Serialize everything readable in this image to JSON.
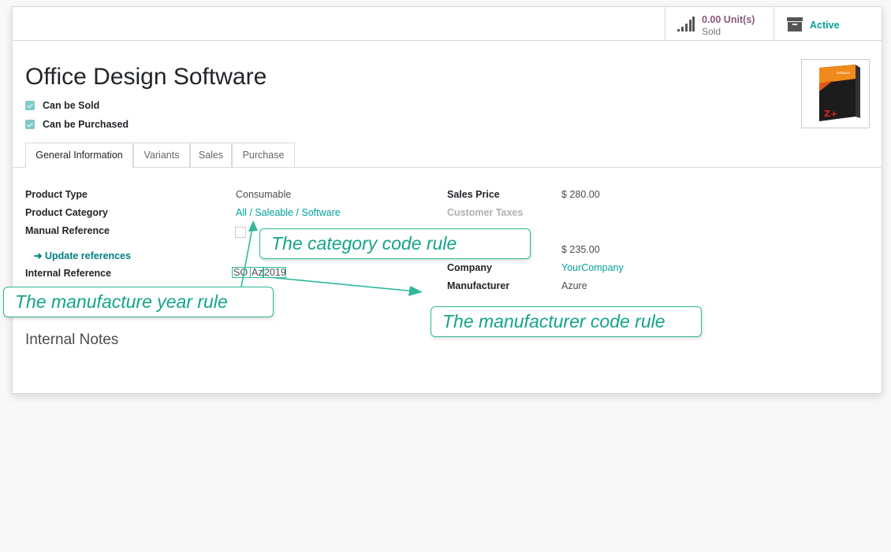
{
  "status": {
    "sold_value": "0.00 Unit(s)",
    "sold_label": "Sold",
    "active_label": "Active"
  },
  "product": {
    "title": "Office Design Software",
    "can_be_sold": "Can be Sold",
    "can_be_purchased": "Can be Purchased"
  },
  "tabs": [
    "General Information",
    "Variants",
    "Sales",
    "Purchase"
  ],
  "fields": {
    "product_type_label": "Product Type",
    "product_type_value": "Consumable",
    "product_category_label": "Product Category",
    "product_category_value": "All / Saleable / Software",
    "manual_reference_label": "Manual Reference",
    "update_references": "Update references",
    "internal_reference_label": "Internal Reference",
    "internal_reference_parts": [
      "SO",
      "Az",
      "2019"
    ],
    "sales_price_label": "Sales Price",
    "sales_price_value": "$ 280.00",
    "customer_taxes_label": "Customer Taxes",
    "cost_value": "$ 235.00",
    "company_label": "Company",
    "company_value": "YourCompany",
    "manufacturer_label": "Manufacturer",
    "manufacturer_value": "Azure"
  },
  "notes_heading": "Internal Notes",
  "annotations": {
    "category_rule": "The category code rule",
    "year_rule": "The manufacture year rule",
    "manufacturer_rule": "The manufacturer code rule"
  },
  "colors": {
    "accent": "#00a09d",
    "status_purple": "#875a7b",
    "callout": "#2fb89c"
  },
  "icons": [
    "signal-bars-icon",
    "archive-icon",
    "arrow-right-icon",
    "checkbox-icon"
  ]
}
